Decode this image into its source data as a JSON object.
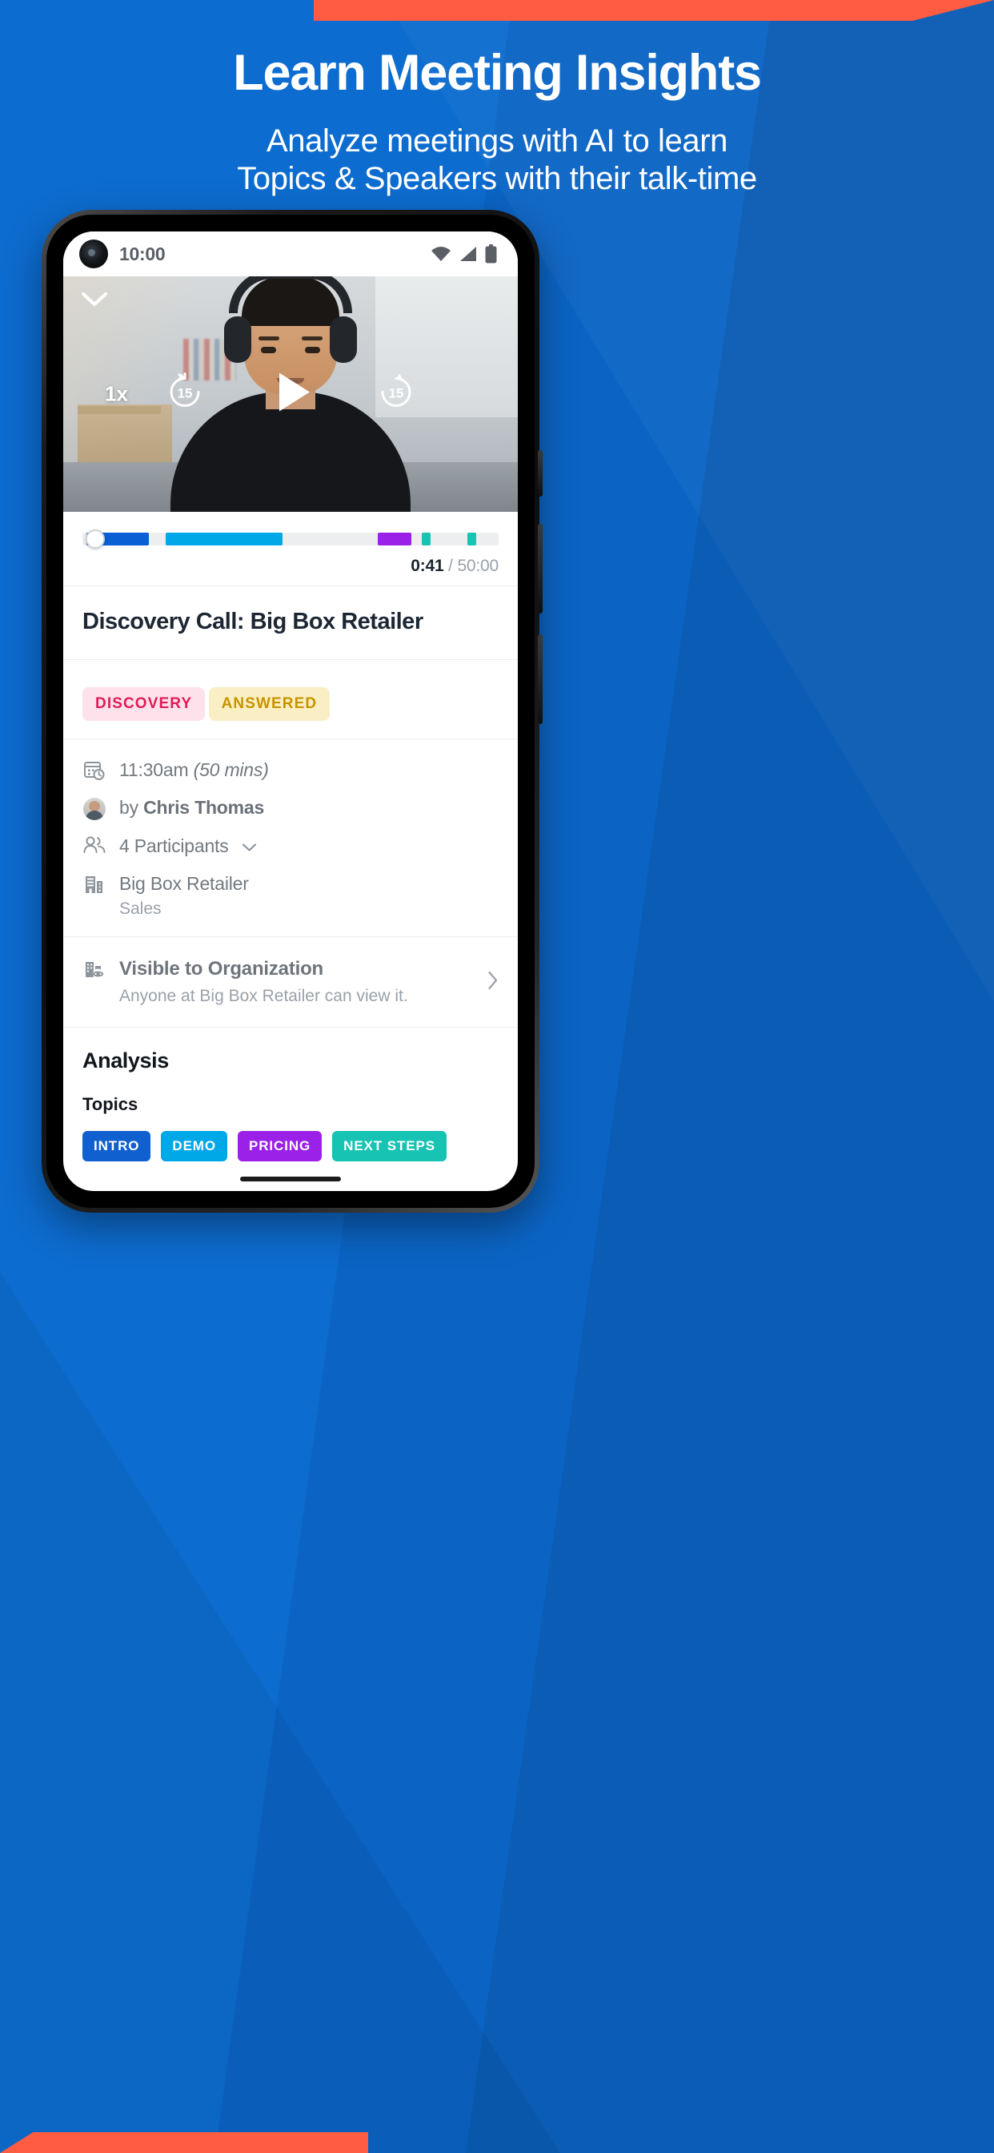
{
  "promo": {
    "headline": "Learn Meeting Insights",
    "subhead_line1": "Analyze meetings with AI to learn",
    "subhead_line2": "Topics & Speakers with their talk-time",
    "bg_color": "#0b64c4",
    "accent_color": "#ff5c42"
  },
  "status_bar": {
    "time": "10:00",
    "wifi_icon": "wifi-icon",
    "signal_icon": "signal-icon",
    "battery_icon": "battery-icon"
  },
  "video": {
    "collapse_icon": "chevron-down-icon",
    "speed_label": "1x",
    "rewind_label": "15",
    "forward_label": "15",
    "play_icon": "play-icon"
  },
  "player": {
    "current_time": "0:41",
    "separator": "/",
    "total_time": "50:00",
    "segments": [
      {
        "name": "INTRO",
        "color": "#0a5fd4",
        "start_pct": 1.0,
        "width_pct": 15.0
      },
      {
        "name": "DEMO",
        "color": "#00a8e8",
        "start_pct": 20.0,
        "width_pct": 28.0
      },
      {
        "name": "PRICING",
        "color": "#9b21e8",
        "start_pct": 71.0,
        "width_pct": 8.0
      },
      {
        "name": "NEXT STEPS",
        "color": "#17c3b2",
        "start_pct": 81.5,
        "width_pct": 2.2
      },
      {
        "name": "NEXT STEPS",
        "color": "#17c3b2",
        "start_pct": 92.5,
        "width_pct": 2.2
      }
    ],
    "playhead_pct": 3.1
  },
  "meeting": {
    "title": "Discovery Call: Big Box Retailer",
    "tags": [
      {
        "label": "DISCOVERY",
        "bg": "#fde2ec",
        "fg": "#e01b57"
      },
      {
        "label": "ANSWERED",
        "bg": "#faeec4",
        "fg": "#c79400"
      }
    ],
    "schedule": {
      "icon": "calendar-clock-icon",
      "time": "11:30am",
      "duration": "(50 mins)"
    },
    "owner": {
      "icon": "avatar",
      "prefix": "by",
      "name": "Chris Thomas"
    },
    "participants": {
      "icon": "people-icon",
      "label": "4 Participants",
      "chevron": "chevron-down-icon"
    },
    "company": {
      "icon": "building-icon",
      "name": "Big Box Retailer",
      "team": "Sales"
    }
  },
  "visibility": {
    "icon": "building-eye-icon",
    "title": "Visible to Organization",
    "subtitle": "Anyone at Big Box Retailer can view it.",
    "arrow_icon": "chevron-right-icon"
  },
  "analysis": {
    "heading": "Analysis",
    "topics_heading": "Topics",
    "topics": [
      {
        "label": "INTRO",
        "color": "#1060cf"
      },
      {
        "label": "DEMO",
        "color": "#00a8e8"
      },
      {
        "label": "PRICING",
        "color": "#9b21e8"
      },
      {
        "label": "NEXT STEPS",
        "color": "#17c3b2"
      }
    ]
  }
}
